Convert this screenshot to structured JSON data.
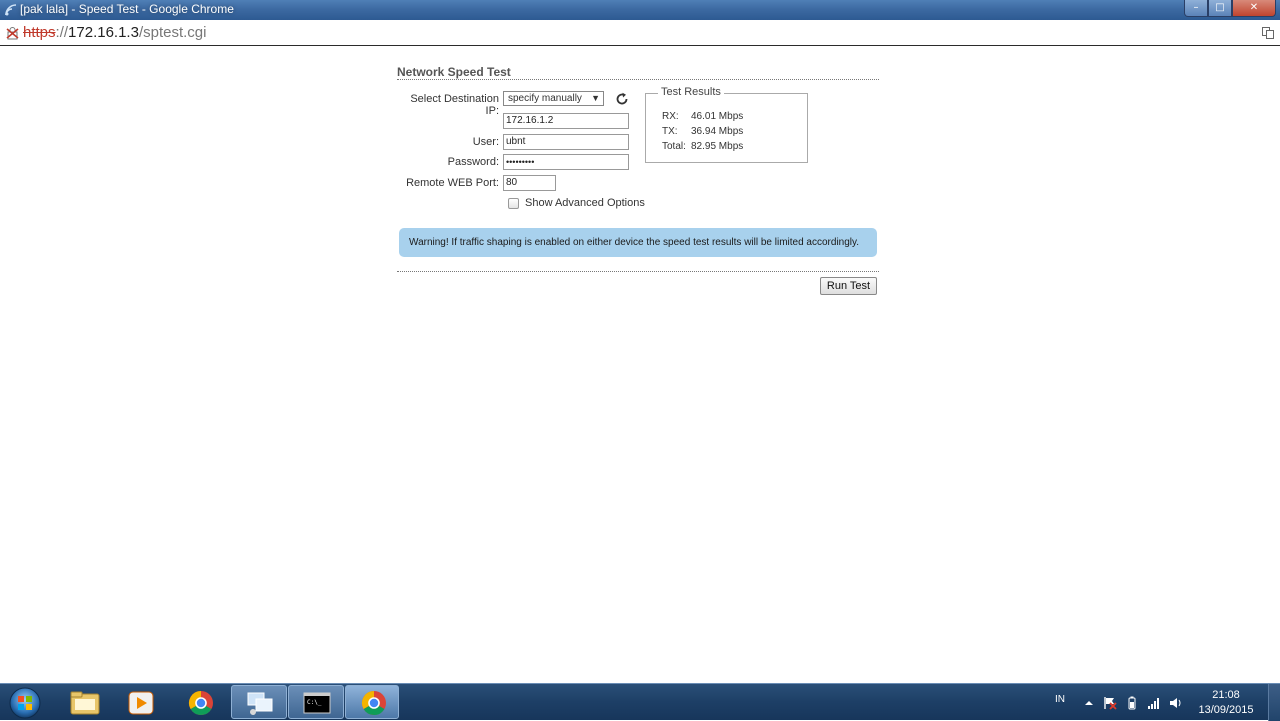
{
  "window": {
    "title": "[pak lala] - Speed Test - Google Chrome",
    "buttons": {
      "minimize": "–",
      "maximize": "□",
      "close": "✕"
    }
  },
  "address": {
    "scheme": "https",
    "separator": "://",
    "host": "172.16.1.3",
    "path": "/sptest.cgi"
  },
  "page": {
    "title": "Network Speed Test",
    "destination_label": "Select Destination IP:",
    "destination_select": "specify manually",
    "ip_value": "172.16.1.2",
    "user_label": "User:",
    "user_value": "ubnt",
    "password_label": "Password:",
    "password_value": "•••••••••",
    "port_label": "Remote WEB Port:",
    "port_value": "80",
    "advanced_label": "Show Advanced Options",
    "results": {
      "legend": "Test Results",
      "rows": [
        {
          "key": "RX:",
          "value": "46.01 Mbps"
        },
        {
          "key": "TX:",
          "value": "36.94 Mbps"
        },
        {
          "key": "Total:",
          "value": "82.95 Mbps"
        }
      ]
    },
    "warning": "Warning! If traffic shaping is enabled on either device the speed test results will be limited accordingly.",
    "run_button": "Run Test"
  },
  "taskbar": {
    "apps": [
      "start-orb",
      "file-explorer",
      "media-player",
      "chrome",
      "remote-desktop",
      "command-prompt",
      "chrome-active"
    ],
    "lang": "IN",
    "time": "21:08",
    "date": "13/09/2015"
  },
  "colors": {
    "titlebar": "#3d6aa2",
    "warning_bg": "#a8d1ed",
    "taskbar": "#1d3f66"
  }
}
